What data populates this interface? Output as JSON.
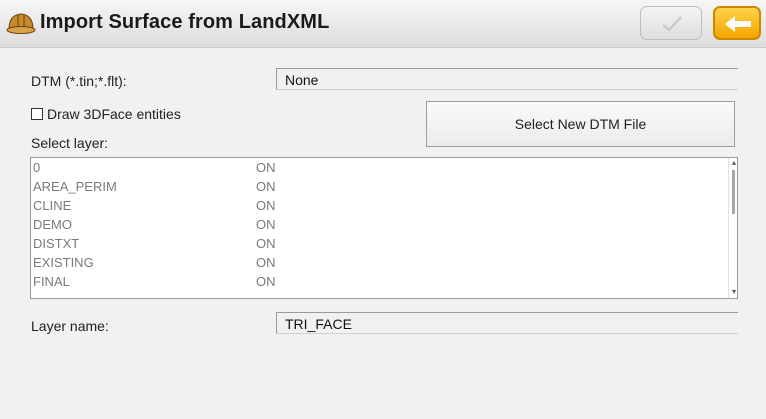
{
  "window": {
    "title": "Import Surface from LandXML",
    "app_icon": "hardhat-icon",
    "ok_icon": "checkmark-icon",
    "back_icon": "arrow-left-icon",
    "back_color": "#f3a500"
  },
  "dtm": {
    "label": "DTM (*.tin;*.flt):",
    "value": "None"
  },
  "draw3dface": {
    "label": "Draw 3DFace entities",
    "checked": false
  },
  "select_button": {
    "label": "Select New DTM File"
  },
  "layers": {
    "label": "Select layer:",
    "items": [
      {
        "name": "0",
        "state": "ON"
      },
      {
        "name": "AREA_PERIM",
        "state": "ON"
      },
      {
        "name": "CLINE",
        "state": "ON"
      },
      {
        "name": "DEMO",
        "state": "ON"
      },
      {
        "name": "DISTXT",
        "state": "ON"
      },
      {
        "name": "EXISTING",
        "state": "ON"
      },
      {
        "name": "FINAL",
        "state": "ON"
      }
    ]
  },
  "layer_name": {
    "label": "Layer name:",
    "value": "TRI_FACE"
  }
}
